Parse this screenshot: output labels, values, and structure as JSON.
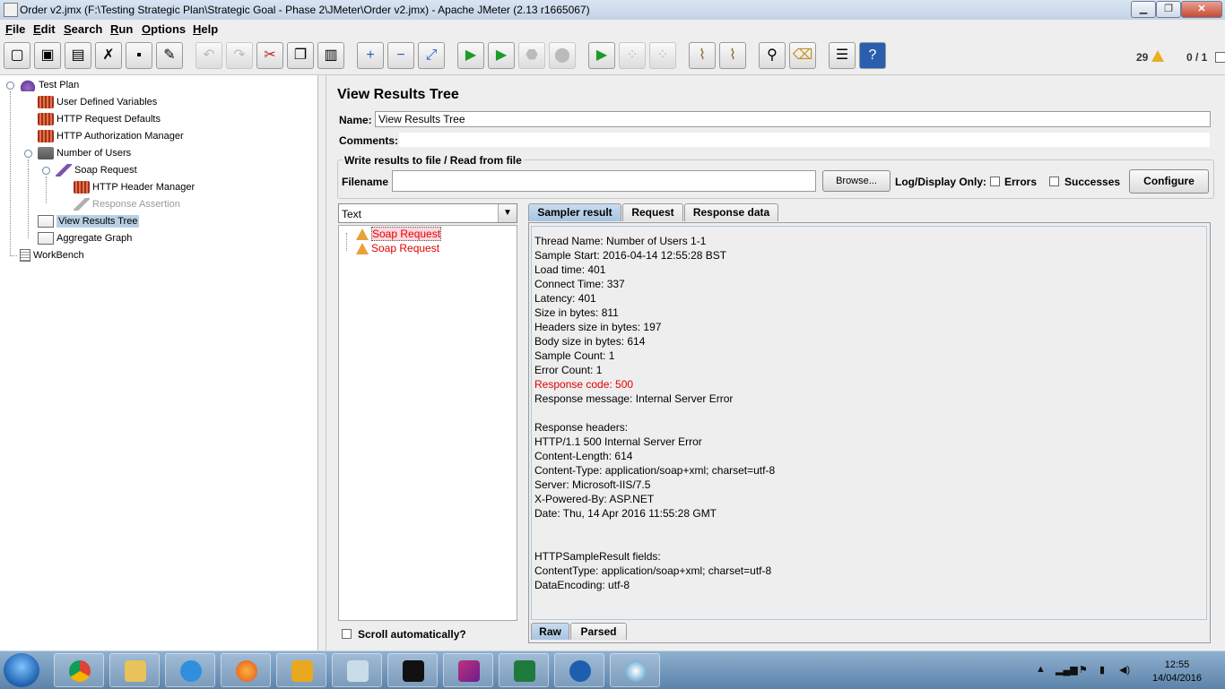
{
  "window": {
    "title": "Order v2.jmx (F:\\Testing Strategic Plan\\Strategic Goal - Phase 2\\JMeter\\Order v2.jmx) - Apache JMeter (2.13 r1665067)",
    "minimize": "▁",
    "maximize": "❐",
    "close": "✕"
  },
  "menu": [
    {
      "label": "File",
      "key": "F",
      "rest": "ile"
    },
    {
      "label": "Edit",
      "key": "E",
      "rest": "dit"
    },
    {
      "label": "Search",
      "key": "S",
      "rest": "earch"
    },
    {
      "label": "Run",
      "key": "R",
      "rest": "un"
    },
    {
      "label": "Options",
      "key": "O",
      "rest": "ptions"
    },
    {
      "label": "Help",
      "key": "H",
      "rest": "elp"
    }
  ],
  "toolbar": {
    "icons": [
      "new-icon",
      "templates-icon",
      "open-icon",
      "close-file-icon",
      "save-icon",
      "save-as-icon",
      "undo-icon",
      "redo-icon",
      "cut-icon",
      "copy-icon",
      "paste-icon",
      "expand-icon",
      "collapse-icon",
      "toggle-icon",
      "start-icon",
      "start-no-pause-icon",
      "stop-icon",
      "shutdown-icon",
      "remote-start-icon",
      "remote-stop-icon",
      "remote-shutdown-icon",
      "clear-icon",
      "clear-all-icon",
      "search-icon",
      "reset-search-icon",
      "function-helper-icon",
      "help-icon"
    ],
    "warning_count": "29",
    "threads": "0 / 1"
  },
  "tree": [
    {
      "label": "Test Plan",
      "icon": "test-plan-icon"
    },
    {
      "label": "User Defined Variables",
      "icon": "config-element-icon"
    },
    {
      "label": "HTTP Request Defaults",
      "icon": "config-element-icon"
    },
    {
      "label": "HTTP Authorization Manager",
      "icon": "config-element-icon"
    },
    {
      "label": "Number of Users",
      "icon": "thread-group-icon"
    },
    {
      "label": "Soap Request",
      "icon": "sampler-icon"
    },
    {
      "label": "HTTP Header Manager",
      "icon": "config-element-icon"
    },
    {
      "label": "Response Assertion",
      "icon": "assertion-icon"
    },
    {
      "label": "View Results Tree",
      "icon": "listener-icon"
    },
    {
      "label": "Aggregate Graph",
      "icon": "listener-icon"
    },
    {
      "label": "WorkBench",
      "icon": "workbench-icon"
    }
  ],
  "panel": {
    "heading": "View Results Tree",
    "name_label": "Name:",
    "name_value": "View Results Tree",
    "comments_label": "Comments:",
    "comments_value": "",
    "file_group_title": "Write results to file / Read from file",
    "filename_label": "Filename",
    "filename_value": "",
    "browse_label": "Browse...",
    "log_display_label": "Log/Display Only:",
    "errors_label": "Errors",
    "errors_checked": false,
    "successes_label": "Successes",
    "successes_checked": false,
    "configure_label": "Configure"
  },
  "results": {
    "renderer": "Text",
    "items": [
      {
        "label": "Soap Request",
        "status": "error",
        "selected": true
      },
      {
        "label": "Soap Request",
        "status": "error",
        "selected": false
      }
    ],
    "scroll_auto_label": "Scroll automatically?",
    "scroll_auto_checked": false
  },
  "detail": {
    "tabs": [
      "Sampler result",
      "Request",
      "Response data"
    ],
    "active_tab": "Sampler result",
    "lines": [
      "Thread Name: Number of Users 1-1",
      "Sample Start: 2016-04-14 12:55:28 BST",
      "Load time: 401",
      "Connect Time: 337",
      "Latency: 401",
      "Size in bytes: 811",
      "Headers size in bytes: 197",
      "Body size in bytes: 614",
      "Sample Count: 1",
      "Error Count: 1",
      "Response code: 500",
      "Response message: Internal Server Error",
      "",
      "Response headers:",
      "HTTP/1.1 500 Internal Server Error",
      "Content-Length: 614",
      "Content-Type: application/soap+xml; charset=utf-8",
      "Server: Microsoft-IIS/7.5",
      "X-Powered-By: ASP.NET",
      "Date: Thu, 14 Apr 2016 11:55:28 GMT",
      "",
      "",
      "HTTPSampleResult fields:",
      "ContentType: application/soap+xml; charset=utf-8",
      "DataEncoding: utf-8"
    ],
    "bottom_tabs": [
      "Raw",
      "Parsed"
    ],
    "active_bottom_tab": "Raw"
  },
  "taskbar": {
    "apps": [
      "chrome-icon",
      "file-explorer-icon",
      "internet-explorer-icon",
      "firefox-icon",
      "outlook-icon",
      "notes-icon",
      "command-prompt-icon",
      "jmeter-icon",
      "excel-icon",
      "r-icon",
      "network-icon"
    ],
    "time": "12:55",
    "date": "14/04/2016"
  }
}
